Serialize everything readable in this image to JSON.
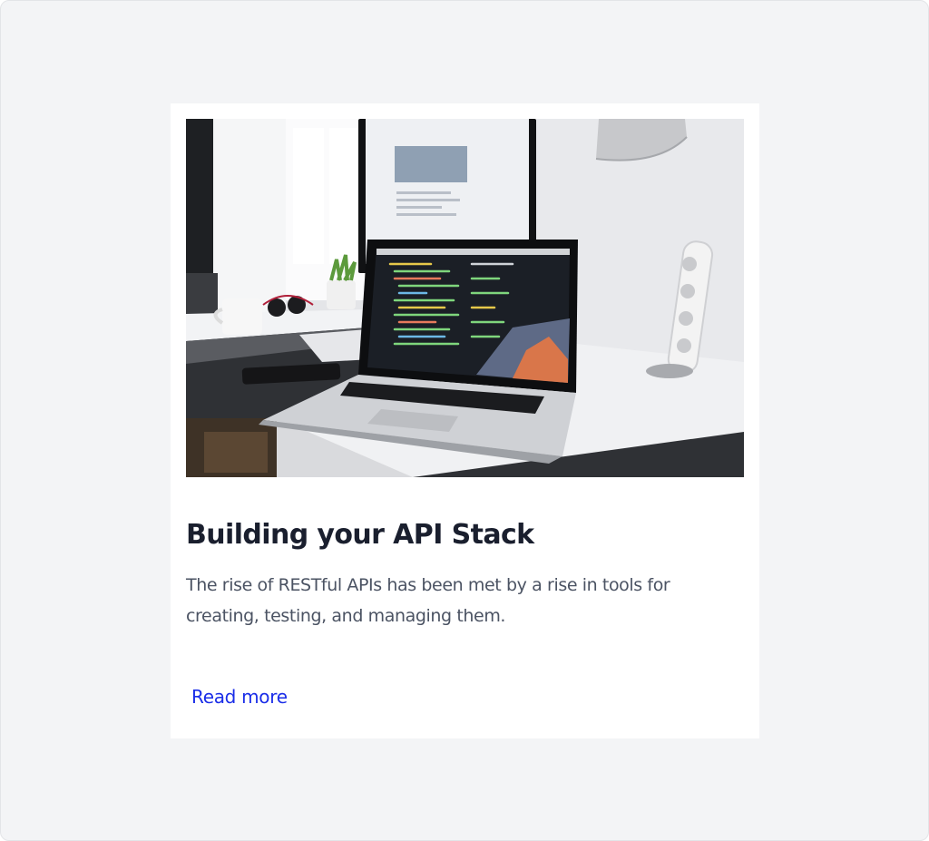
{
  "card": {
    "image_alt": "Laptop with code editor on a white desk next to a monitor",
    "title": "Building your API Stack",
    "excerpt": "The rise of RESTful APIs has been met by a rise in tools for creating, testing, and managing them.",
    "read_more_label": "Read more"
  },
  "colors": {
    "page_background": "#f3f4f6",
    "card_background": "#ffffff",
    "title": "#1a1f2e",
    "body_text": "#4b5363",
    "link": "#1a2de8"
  }
}
